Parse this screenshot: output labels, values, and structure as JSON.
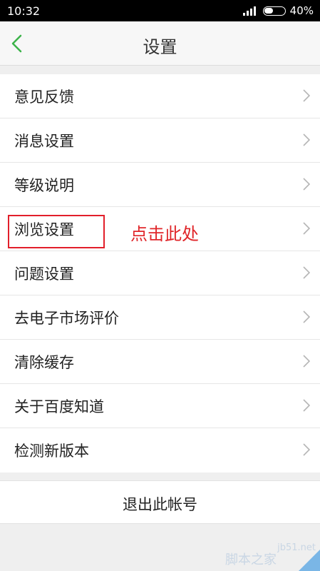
{
  "status": {
    "time": "10:32",
    "battery": "40%"
  },
  "header": {
    "title": "设置",
    "back_icon": "chevron-left-icon"
  },
  "colors": {
    "accent": "#3cb34a",
    "annotation": "#e0262a"
  },
  "settings": {
    "items": [
      {
        "label": "意见反馈"
      },
      {
        "label": "消息设置"
      },
      {
        "label": "等级说明"
      },
      {
        "label": "浏览设置"
      },
      {
        "label": "问题设置"
      },
      {
        "label": "去电子市场评价"
      },
      {
        "label": "清除缓存"
      },
      {
        "label": "关于百度知道"
      },
      {
        "label": "检测新版本"
      }
    ]
  },
  "annotation": {
    "text": "点击此处"
  },
  "logout": {
    "label": "退出此帐号"
  },
  "watermark": {
    "site": "jb51.net",
    "text": "脚本之家"
  }
}
